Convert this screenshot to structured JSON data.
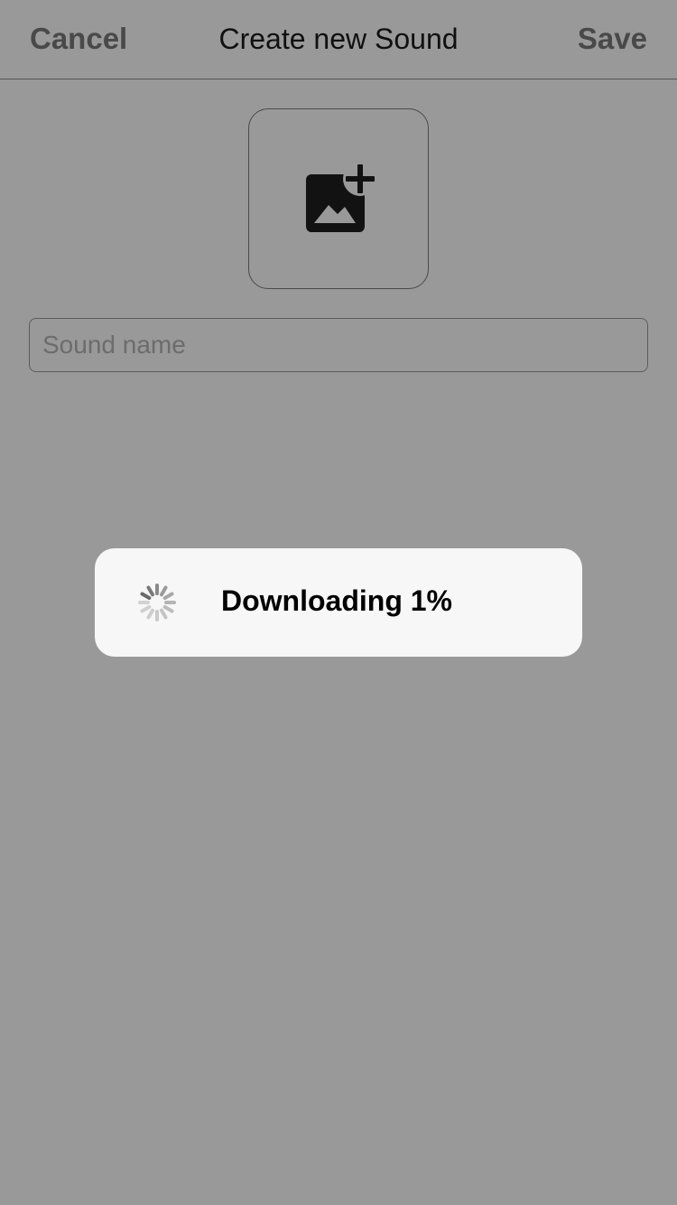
{
  "navbar": {
    "cancel_label": "Cancel",
    "title": "Create new Sound",
    "save_label": "Save"
  },
  "image_picker": {
    "icon": "add-photo-icon"
  },
  "sound_name": {
    "value": "",
    "placeholder": "Sound name"
  },
  "progress_hud": {
    "message": "Downloading 1%",
    "progress_percent": 1,
    "icon": "activity-spinner-icon"
  },
  "colors": {
    "overlay": "rgba(0,0,0,0.4)",
    "hud_background": "#f7f7f7",
    "nav_button": "#7a7a7a"
  }
}
